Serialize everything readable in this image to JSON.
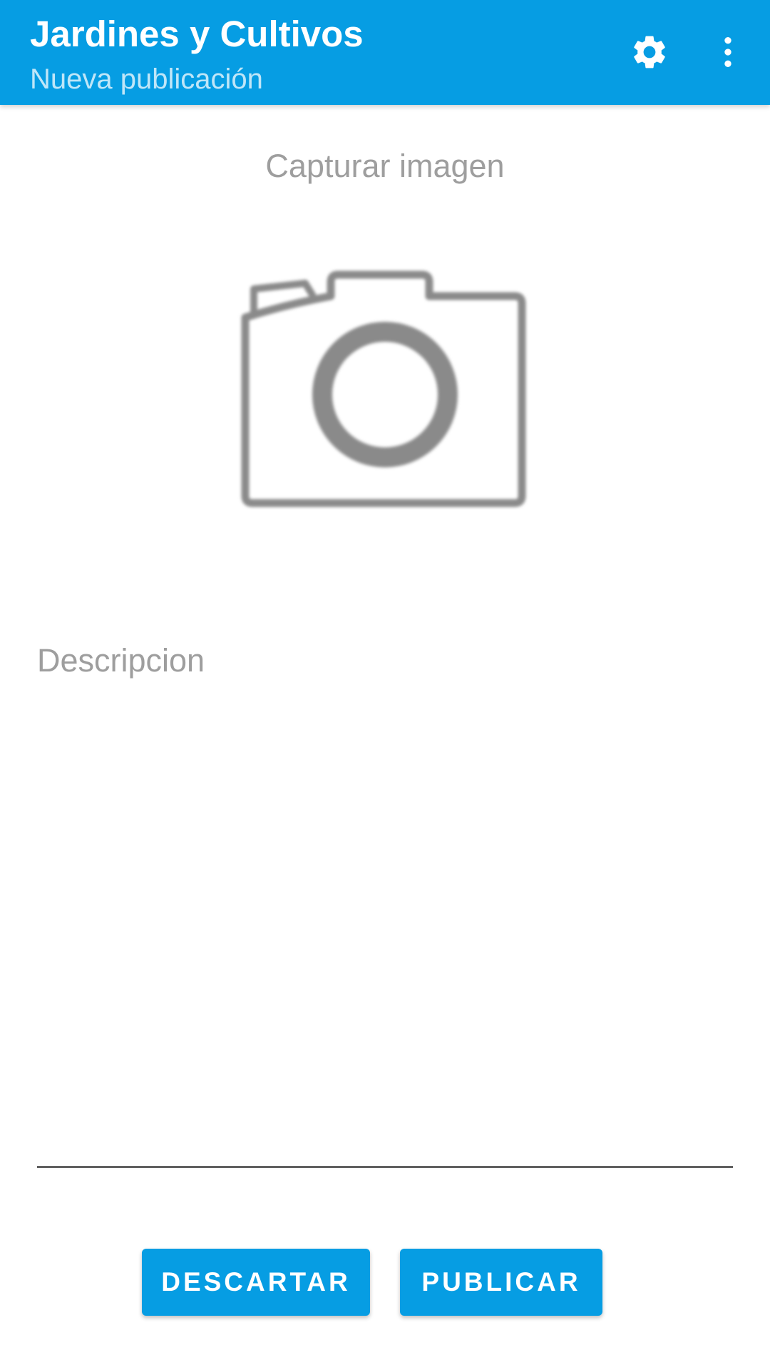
{
  "app_bar": {
    "title": "Jardines y Cultivos",
    "subtitle": "Nueva publicación",
    "background_color": "#069de3",
    "actions": [
      {
        "icon": "gear-icon"
      },
      {
        "icon": "more-vert-icon"
      }
    ]
  },
  "capture": {
    "label": "Capturar imagen",
    "icon": "camera-icon"
  },
  "description": {
    "placeholder": "Descripcion",
    "value": ""
  },
  "buttons": {
    "discard_label": "DESCARTAR",
    "publish_label": "PUBLICAR"
  }
}
